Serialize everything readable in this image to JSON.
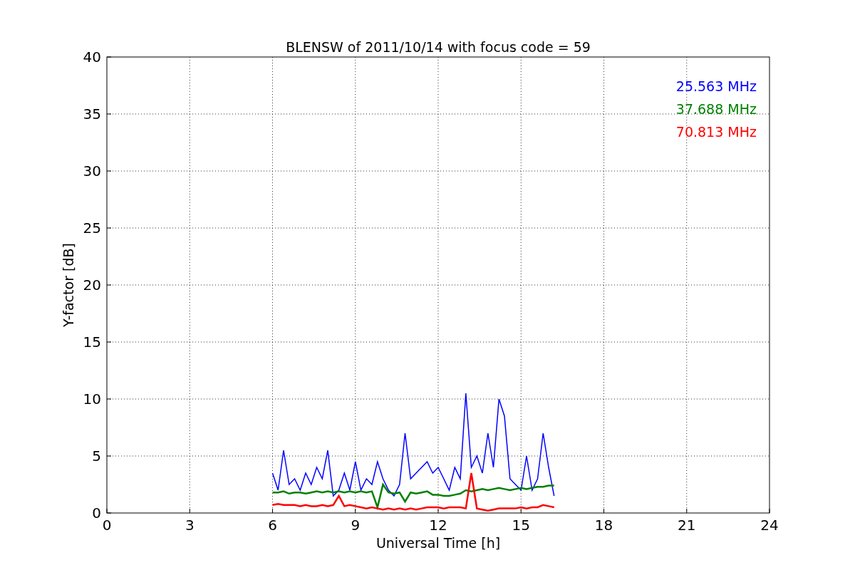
{
  "chart_data": {
    "type": "line",
    "title": "BLENSW of 2011/10/14 with focus code = 59",
    "xlabel": "Universal Time [h]",
    "ylabel": "Y-factor [dB]",
    "x": [
      6.0,
      6.2,
      6.4,
      6.6,
      6.8,
      7.0,
      7.2,
      7.4,
      7.6,
      7.8,
      8.0,
      8.2,
      8.4,
      8.6,
      8.8,
      9.0,
      9.2,
      9.4,
      9.6,
      9.8,
      10.0,
      10.2,
      10.4,
      10.6,
      10.8,
      11.0,
      11.2,
      11.4,
      11.6,
      11.8,
      12.0,
      12.2,
      12.4,
      12.6,
      12.8,
      13.0,
      13.2,
      13.4,
      13.6,
      13.8,
      14.0,
      14.2,
      14.4,
      14.6,
      14.8,
      15.0,
      15.2,
      15.4,
      15.6,
      15.8,
      16.0,
      16.2
    ],
    "series": [
      {
        "name": "25.563 MHz",
        "color": "#0000ff",
        "values": [
          3.5,
          2,
          5.5,
          2.5,
          3,
          2,
          3.5,
          2.5,
          4,
          3,
          5.5,
          1.5,
          2,
          3.5,
          2,
          4.5,
          2,
          3,
          2.5,
          4.5,
          3,
          2,
          1.5,
          2.5,
          7,
          3,
          3.5,
          4,
          4.5,
          3.5,
          4,
          3,
          2,
          4,
          3,
          10.5,
          4,
          5,
          3.5,
          7,
          4,
          10,
          8.5,
          3,
          2.5,
          2,
          5,
          2,
          3,
          7,
          4,
          1.5
        ]
      },
      {
        "name": "37.688 MHz",
        "color": "#008000",
        "values": [
          1.8,
          1.8,
          1.9,
          1.7,
          1.8,
          1.8,
          1.7,
          1.8,
          1.9,
          1.8,
          1.9,
          1.8,
          1.9,
          1.8,
          1.9,
          1.8,
          1.9,
          1.8,
          1.9,
          0.5,
          2.5,
          1.8,
          1.7,
          1.8,
          1.0,
          1.8,
          1.7,
          1.8,
          1.9,
          1.6,
          1.6,
          1.5,
          1.5,
          1.6,
          1.7,
          2.0,
          1.9,
          2.0,
          2.1,
          2.0,
          2.1,
          2.2,
          2.1,
          2.0,
          2.1,
          2.2,
          2.1,
          2.2,
          2.3,
          2.3,
          2.4,
          2.4
        ]
      },
      {
        "name": "70.813 MHz",
        "color": "#ff0000",
        "values": [
          0.7,
          0.8,
          0.7,
          0.7,
          0.7,
          0.6,
          0.7,
          0.6,
          0.6,
          0.7,
          0.6,
          0.7,
          1.5,
          0.6,
          0.7,
          0.6,
          0.5,
          0.4,
          0.5,
          0.4,
          0.3,
          0.4,
          0.3,
          0.4,
          0.3,
          0.4,
          0.3,
          0.4,
          0.5,
          0.5,
          0.5,
          0.4,
          0.5,
          0.5,
          0.5,
          0.4,
          3.5,
          0.4,
          0.3,
          0.2,
          0.3,
          0.4,
          0.4,
          0.4,
          0.4,
          0.5,
          0.4,
          0.5,
          0.5,
          0.7,
          0.6,
          0.5
        ]
      }
    ],
    "grid": true,
    "xlim": [
      0,
      24
    ],
    "ylim": [
      0,
      40
    ],
    "xticks": [
      0,
      3,
      6,
      9,
      12,
      15,
      18,
      21,
      24
    ],
    "yticks": [
      0,
      5,
      10,
      15,
      20,
      25,
      30,
      35,
      40
    ]
  }
}
